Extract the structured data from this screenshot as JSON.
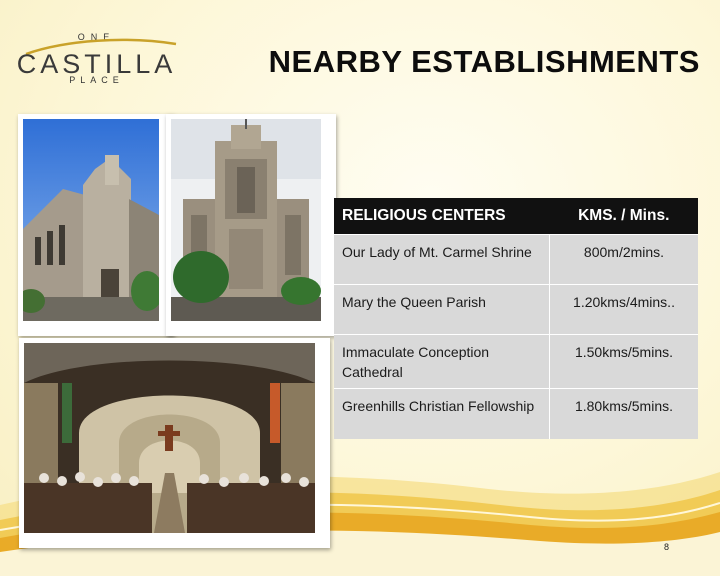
{
  "logo": {
    "top": "ONE",
    "name": "CASTILLA",
    "bottom": "PLACE"
  },
  "title": "NEARBY ESTABLISHMENTS",
  "table": {
    "headers": [
      "RELIGIOUS CENTERS",
      "KMS. / Mins."
    ],
    "rows": [
      {
        "name": "Our Lady of Mt. Carmel Shrine",
        "distance": "800m/2mins."
      },
      {
        "name": "Mary the Queen Parish",
        "distance": "1.20kms/4mins.."
      },
      {
        "name": "Immaculate Conception Cathedral",
        "distance": "1.50kms/5mins."
      },
      {
        "name": "Greenhills Christian Fellowship",
        "distance": "1.80kms/5mins."
      }
    ]
  },
  "page_number": "8",
  "colors": {
    "header_bg": "#111111",
    "row_bg": "#d9d9d9",
    "accent_gold": "#e9b820"
  }
}
